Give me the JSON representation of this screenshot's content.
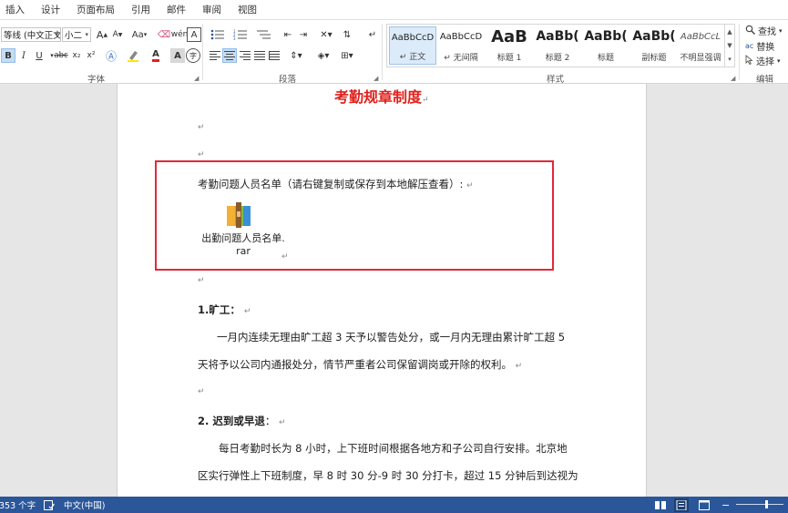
{
  "tabs": [
    "插入",
    "设计",
    "页面布局",
    "引用",
    "邮件",
    "审阅",
    "视图"
  ],
  "ribbon": {
    "font_group": {
      "label": "字体",
      "font_name": "等线 (中文正文",
      "font_size": "小二",
      "grow_label": "A",
      "shrink_label": "A",
      "case_label": "Aa",
      "bold": "B",
      "italic": "I",
      "underline": "U",
      "strike": "abc",
      "subscript": "x₂",
      "superscript": "x²",
      "font_color_label": "A",
      "char_border_label": "A",
      "enclose_label": "字"
    },
    "paragraph_group": {
      "label": "段落"
    },
    "styles_group": {
      "label": "样式",
      "styles": [
        {
          "sample": "AaBbCcD",
          "name": "↵ 正文",
          "selected": true
        },
        {
          "sample": "AaBbCcD",
          "name": "↵ 无间隔",
          "selected": false
        },
        {
          "sample": "AaB",
          "name": "标题 1",
          "selected": false
        },
        {
          "sample": "AaBb(",
          "name": "标题 2",
          "selected": false
        },
        {
          "sample": "AaBb(",
          "name": "标题",
          "selected": false
        },
        {
          "sample": "AaBb(",
          "name": "副标题",
          "selected": false
        },
        {
          "sample": "AaBbCcL",
          "name": "不明显强调",
          "selected": false
        }
      ]
    },
    "editing_group": {
      "label": "编辑",
      "find": "查找",
      "replace": "替换",
      "select": "选择"
    }
  },
  "document": {
    "title": "考勤规章制度",
    "para_mark": "↵",
    "attachment_intro": "考勤问题人员名单（请右键复制或保存到本地解压查看）:",
    "attachment_caption_line1": "出勤问题人员名单.",
    "attachment_caption_line2": "rar",
    "section1_heading": "1.旷工：",
    "section1_line1": "一月内连续无理由旷工超 3 天予以警告处分，或一月内无理由累计旷工超 5",
    "section1_line2": "天将予以公司内通报处分，情节严重者公司保留调岗或开除的权利。",
    "section2_heading": "2. 迟到或早退",
    "section2_colon": "：",
    "section2_line1": "每日考勤时长为 8 小时，上下班时间根据各地方和子公司自行安排。北京地",
    "section2_line2": "区实行弹性上下班制度，早 8 时 30 分-9 时 30 分打卡，超过 15 分钟后到达视为"
  },
  "statusbar": {
    "word_count": "353 个字",
    "language": "中文(中国)"
  },
  "colors": {
    "title_red": "#e0201a",
    "box_red": "#e0293a",
    "statusbar_blue": "#2b579a"
  }
}
